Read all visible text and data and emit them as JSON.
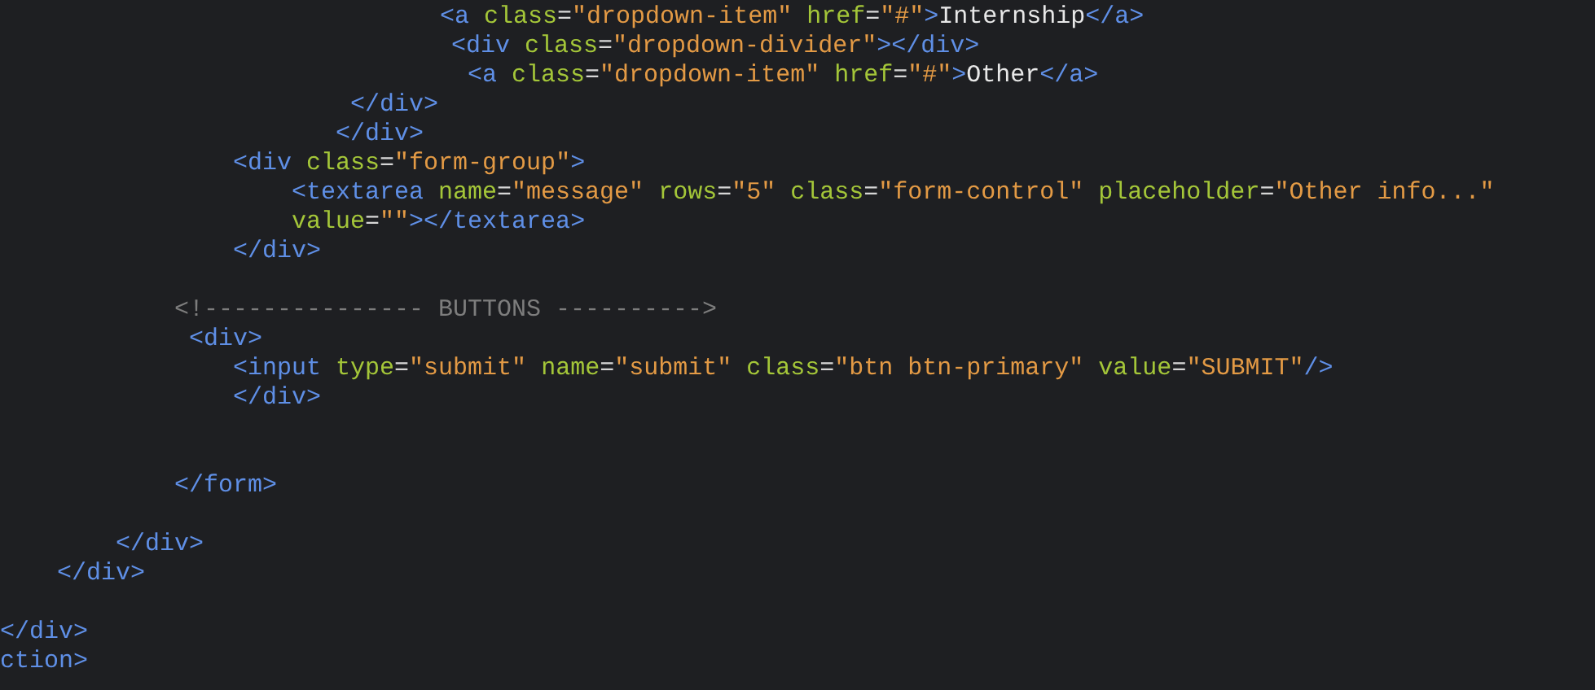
{
  "code_lines": [
    {
      "tokens": [
        {
          "kind": "tag",
          "text": "<a "
        },
        {
          "kind": "attr",
          "text": "class"
        },
        {
          "kind": "punct",
          "text": "="
        },
        {
          "kind": "str",
          "text": "\"dropdown-item\""
        },
        {
          "kind": "attr",
          "text": " href"
        },
        {
          "kind": "punct",
          "text": "="
        },
        {
          "kind": "str",
          "text": "\"#\""
        },
        {
          "kind": "tag",
          "text": ">"
        },
        {
          "kind": "text",
          "text": "Internship"
        },
        {
          "kind": "tag",
          "text": "</a>"
        }
      ]
    },
    {
      "tokens": [
        {
          "kind": "tag",
          "text": "<div "
        },
        {
          "kind": "attr",
          "text": "class"
        },
        {
          "kind": "punct",
          "text": "="
        },
        {
          "kind": "str",
          "text": "\"dropdown-divider\""
        },
        {
          "kind": "tag",
          "text": "></div>"
        }
      ]
    },
    {
      "tokens": [
        {
          "kind": "tag",
          "text": "<a "
        },
        {
          "kind": "attr",
          "text": "class"
        },
        {
          "kind": "punct",
          "text": "="
        },
        {
          "kind": "str",
          "text": "\"dropdown-item\""
        },
        {
          "kind": "attr",
          "text": " href"
        },
        {
          "kind": "punct",
          "text": "="
        },
        {
          "kind": "str",
          "text": "\"#\""
        },
        {
          "kind": "tag",
          "text": ">"
        },
        {
          "kind": "text",
          "text": "Other"
        },
        {
          "kind": "tag",
          "text": "</a>"
        }
      ]
    },
    {
      "tokens": [
        {
          "kind": "tag",
          "text": "</div>"
        }
      ]
    },
    {
      "tokens": [
        {
          "kind": "tag",
          "text": "</div>"
        }
      ]
    },
    {
      "tokens": [
        {
          "kind": "tag",
          "text": "<div "
        },
        {
          "kind": "attr",
          "text": "class"
        },
        {
          "kind": "punct",
          "text": "="
        },
        {
          "kind": "str",
          "text": "\"form-group\""
        },
        {
          "kind": "tag",
          "text": ">"
        }
      ]
    },
    {
      "tokens": [
        {
          "kind": "tag",
          "text": "<textarea "
        },
        {
          "kind": "attr",
          "text": "name"
        },
        {
          "kind": "punct",
          "text": "="
        },
        {
          "kind": "str",
          "text": "\"message\""
        },
        {
          "kind": "attr",
          "text": " rows"
        },
        {
          "kind": "punct",
          "text": "="
        },
        {
          "kind": "str",
          "text": "\"5\""
        },
        {
          "kind": "attr",
          "text": " class"
        },
        {
          "kind": "punct",
          "text": "="
        },
        {
          "kind": "str",
          "text": "\"form-control\""
        },
        {
          "kind": "attr",
          "text": " placeholder"
        },
        {
          "kind": "punct",
          "text": "="
        },
        {
          "kind": "str",
          "text": "\"Other info...\""
        }
      ]
    },
    {
      "tokens": [
        {
          "kind": "attr",
          "text": "value"
        },
        {
          "kind": "punct",
          "text": "="
        },
        {
          "kind": "str",
          "text": "\"\""
        },
        {
          "kind": "tag",
          "text": "></textarea>"
        }
      ]
    },
    {
      "tokens": [
        {
          "kind": "tag",
          "text": "</div>"
        }
      ]
    },
    {
      "tokens": [
        {
          "kind": "comment",
          "text": "<!--------------- BUTTONS ---------->"
        }
      ]
    },
    {
      "tokens": [
        {
          "kind": "tag",
          "text": "<div>"
        }
      ]
    },
    {
      "tokens": [
        {
          "kind": "tag",
          "text": "<input "
        },
        {
          "kind": "attr",
          "text": "type"
        },
        {
          "kind": "punct",
          "text": "="
        },
        {
          "kind": "str",
          "text": "\"submit\""
        },
        {
          "kind": "attr",
          "text": " name"
        },
        {
          "kind": "punct",
          "text": "="
        },
        {
          "kind": "str",
          "text": "\"submit\""
        },
        {
          "kind": "attr",
          "text": " class"
        },
        {
          "kind": "punct",
          "text": "="
        },
        {
          "kind": "str",
          "text": "\"btn btn-primary\""
        },
        {
          "kind": "attr",
          "text": " value"
        },
        {
          "kind": "punct",
          "text": "="
        },
        {
          "kind": "str",
          "text": "\"SUBMIT\""
        },
        {
          "kind": "tag",
          "text": "/>"
        }
      ]
    },
    {
      "tokens": [
        {
          "kind": "tag",
          "text": "</div>"
        }
      ]
    },
    {
      "tokens": [
        {
          "kind": "tag",
          "text": "</form>"
        }
      ]
    },
    {
      "tokens": [
        {
          "kind": "tag",
          "text": "</div>"
        }
      ]
    },
    {
      "tokens": [
        {
          "kind": "tag",
          "text": "</div>"
        }
      ]
    },
    {
      "tokens": [
        {
          "kind": "tag",
          "text": "</div>"
        }
      ]
    },
    {
      "tokens": [
        {
          "kind": "tag",
          "text": "ction>"
        }
      ]
    }
  ]
}
